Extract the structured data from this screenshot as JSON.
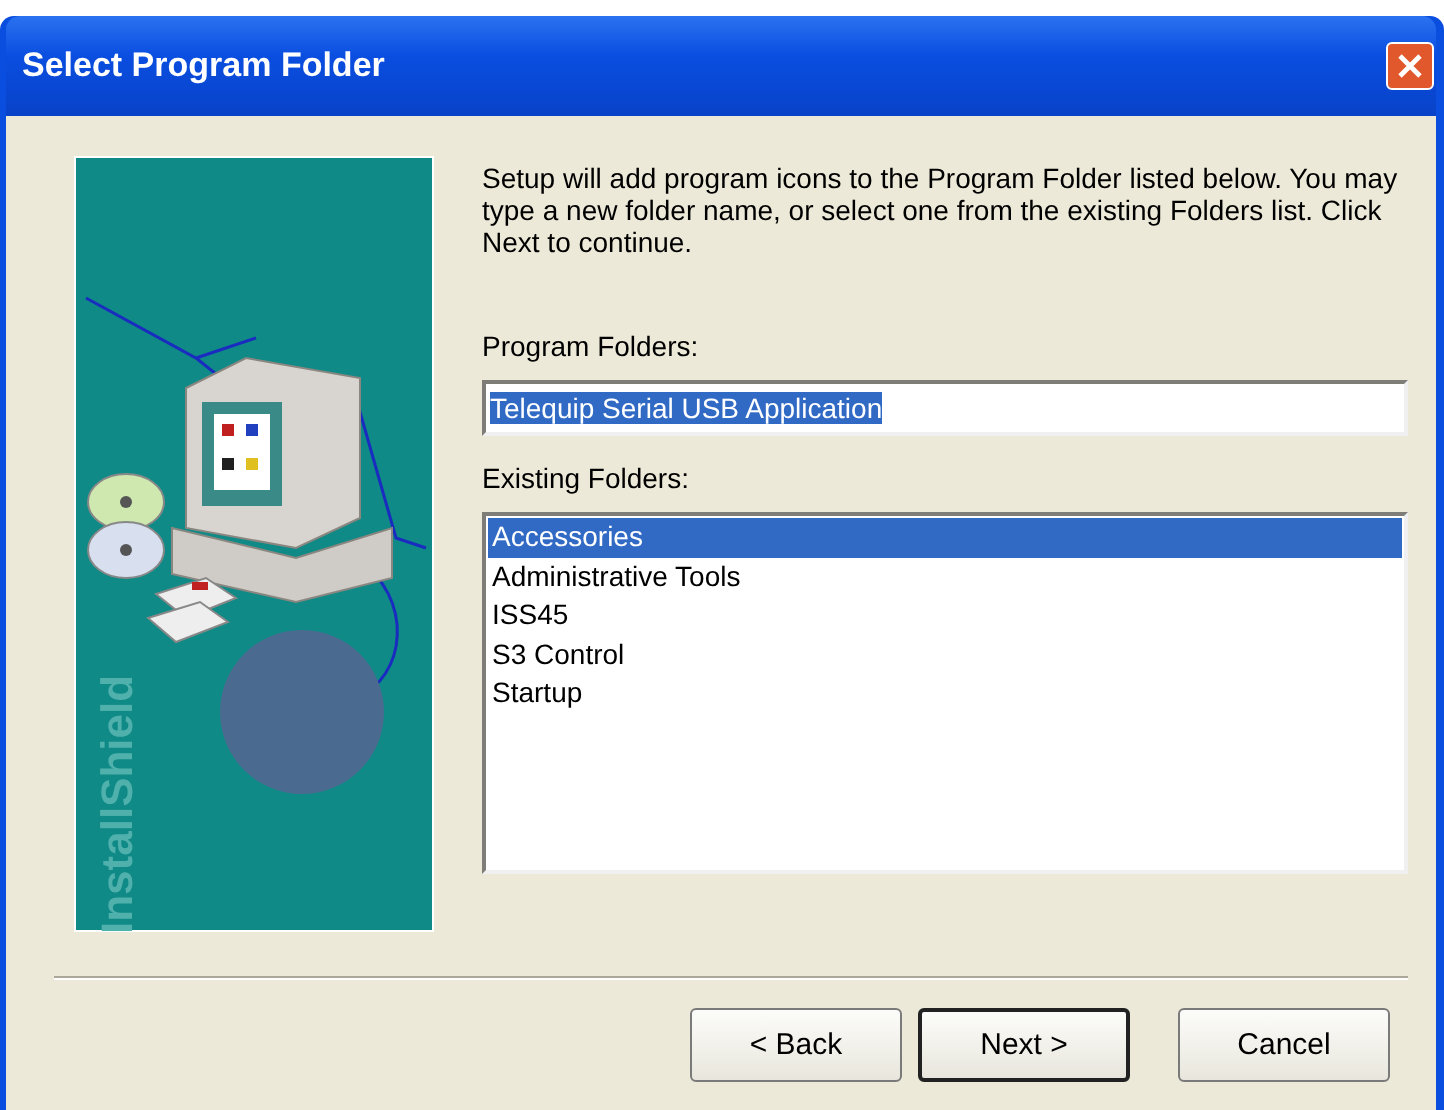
{
  "window": {
    "title": "Select Program Folder"
  },
  "banner": {
    "brand": "InstallShield"
  },
  "intro": "Setup will add program icons to the Program Folder listed below. You may type a new folder name, or select one from the existing Folders list.  Click Next to continue.",
  "program_folder": {
    "label": "Program Folders:",
    "value": "Telequip Serial USB Application",
    "selected": true
  },
  "existing": {
    "label": "Existing Folders:",
    "items": [
      {
        "label": "Accessories",
        "selected": true
      },
      {
        "label": "Administrative Tools",
        "selected": false
      },
      {
        "label": "ISS45",
        "selected": false
      },
      {
        "label": "S3 Control",
        "selected": false
      },
      {
        "label": "Startup",
        "selected": false
      }
    ]
  },
  "buttons": [
    {
      "label": "< Back",
      "default": false
    },
    {
      "label": "Next >",
      "default": true
    },
    {
      "label": "Cancel",
      "default": false
    }
  ]
}
